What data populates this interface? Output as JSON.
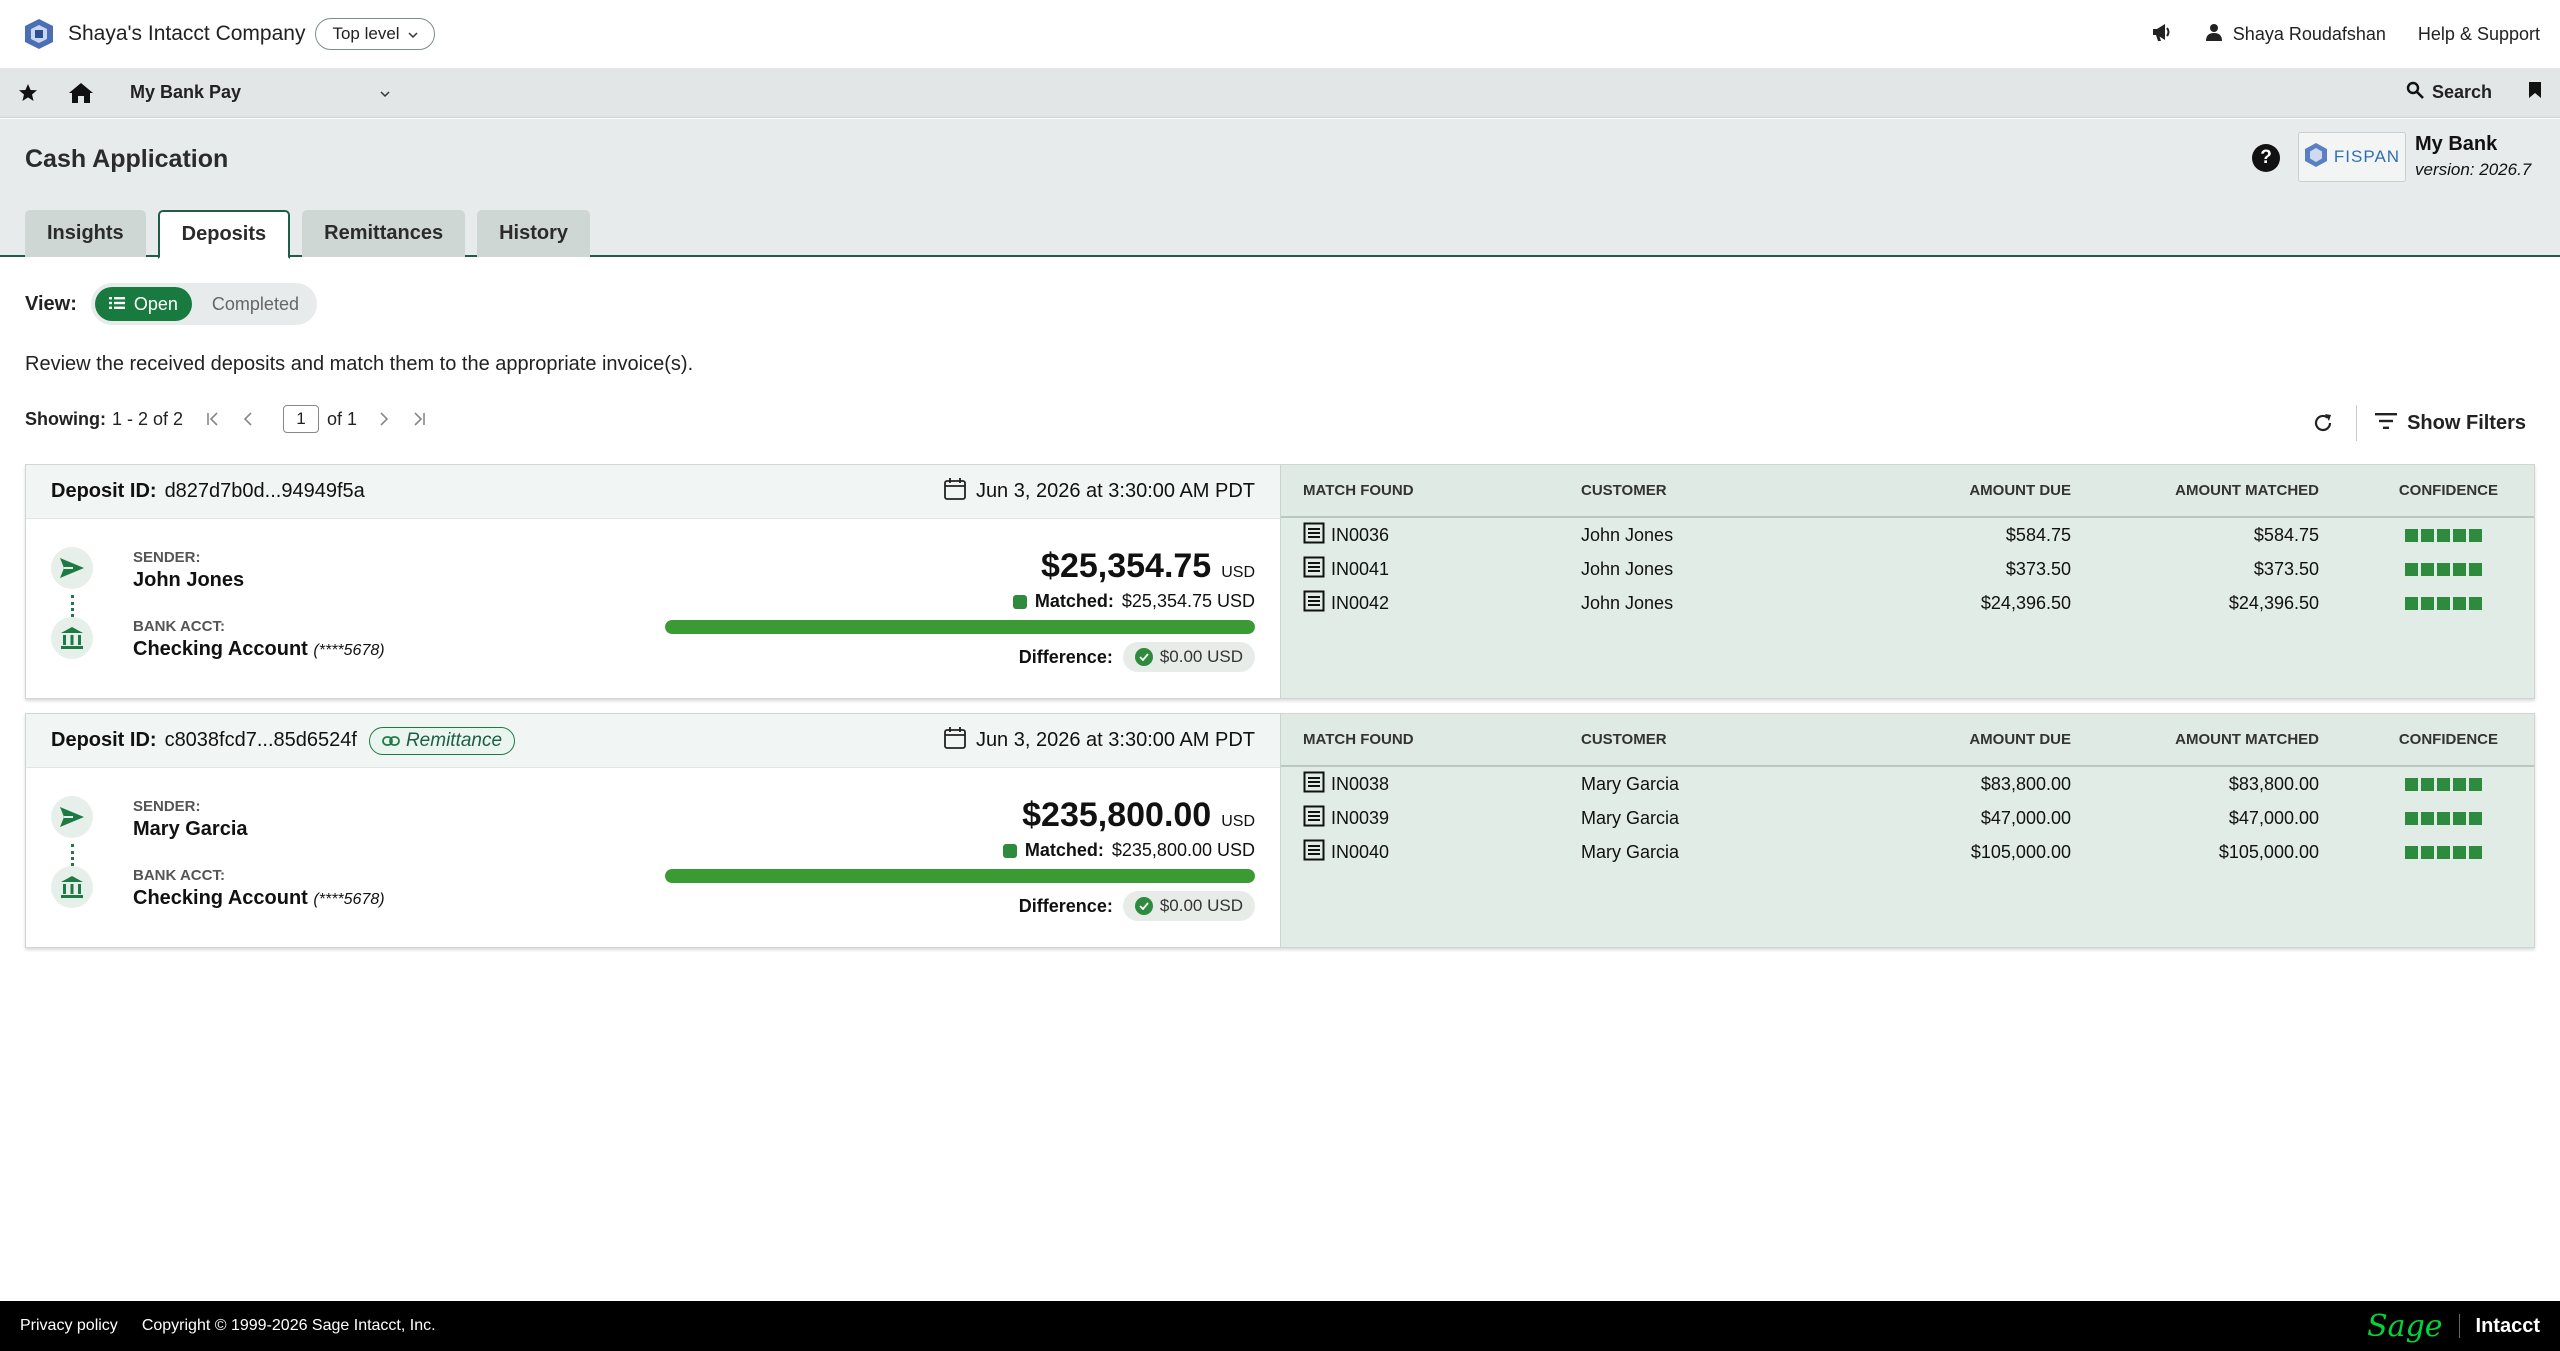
{
  "topbar": {
    "company": "Shaya's Intacct Company",
    "level": "Top level",
    "user": "Shaya Roudafshan",
    "help": "Help & Support"
  },
  "navbar": {
    "app": "My Bank Pay",
    "search": "Search"
  },
  "header": {
    "title": "Cash Application",
    "help_icon": "?",
    "partner_logo_text": "FISPAN",
    "bank_name": "My Bank",
    "version": "version: 2026.7",
    "tabs": [
      {
        "label": "Insights"
      },
      {
        "label": "Deposits",
        "active": true
      },
      {
        "label": "Remittances"
      },
      {
        "label": "History"
      }
    ]
  },
  "view": {
    "label": "View:",
    "open": "Open",
    "completed": "Completed",
    "selected": "Open"
  },
  "instruction": "Review the received deposits and match them to the appropriate invoice(s).",
  "pager": {
    "showing_label": "Showing:",
    "range": "1 - 2 of 2",
    "page": "1",
    "of": "of 1"
  },
  "filters_label": "Show Filters",
  "table_headers": {
    "match": "MATCH FOUND",
    "customer": "CUSTOMER",
    "due": "AMOUNT DUE",
    "matched": "AMOUNT MATCHED",
    "confidence": "CONFIDENCE"
  },
  "deposits": [
    {
      "id_label": "Deposit ID:",
      "id": "d827d7b0d...94949f5a",
      "date": "Jun 3, 2026 at 3:30:00 AM PDT",
      "sender_label": "SENDER:",
      "sender": "John Jones",
      "bank_label": "BANK ACCT:",
      "bank": "Checking Account",
      "bank_mask": "(****5678)",
      "amount": "$25,354.75",
      "currency": "USD",
      "matched_label": "Matched:",
      "matched": "$25,354.75 USD",
      "matched_fraction": 1.0,
      "difference_label": "Difference:",
      "difference": "$0.00 USD",
      "matches": [
        {
          "invoice": "IN0036",
          "customer": "John Jones",
          "due": "$584.75",
          "matched": "$584.75",
          "confidence": 5
        },
        {
          "invoice": "IN0041",
          "customer": "John Jones",
          "due": "$373.50",
          "matched": "$373.50",
          "confidence": 5
        },
        {
          "invoice": "IN0042",
          "customer": "John Jones",
          "due": "$24,396.50",
          "matched": "$24,396.50",
          "confidence": 5
        }
      ]
    },
    {
      "id_label": "Deposit ID:",
      "id": "c8038fcd7...85d6524f",
      "badge": "Remittance",
      "date": "Jun 3, 2026 at 3:30:00 AM PDT",
      "sender_label": "SENDER:",
      "sender": "Mary Garcia",
      "bank_label": "BANK ACCT:",
      "bank": "Checking Account",
      "bank_mask": "(****5678)",
      "amount": "$235,800.00",
      "currency": "USD",
      "matched_label": "Matched:",
      "matched": "$235,800.00 USD",
      "matched_fraction": 1.0,
      "difference_label": "Difference:",
      "difference": "$0.00 USD",
      "matches": [
        {
          "invoice": "IN0038",
          "customer": "Mary Garcia",
          "due": "$83,800.00",
          "matched": "$83,800.00",
          "confidence": 5
        },
        {
          "invoice": "IN0039",
          "customer": "Mary Garcia",
          "due": "$47,000.00",
          "matched": "$47,000.00",
          "confidence": 5
        },
        {
          "invoice": "IN0040",
          "customer": "Mary Garcia",
          "due": "$105,000.00",
          "matched": "$105,000.00",
          "confidence": 5
        }
      ]
    }
  ],
  "footer": {
    "privacy": "Privacy policy",
    "copyright": "Copyright © 1999-2026 Sage Intacct, Inc.",
    "brand_sage": "Sage",
    "brand_intacct": "Intacct"
  },
  "colors": {
    "accent_green": "#187a3f",
    "header_bg": "#e7ebeb",
    "match_bg": "#e1ece6",
    "footer_bg": "#000000"
  }
}
